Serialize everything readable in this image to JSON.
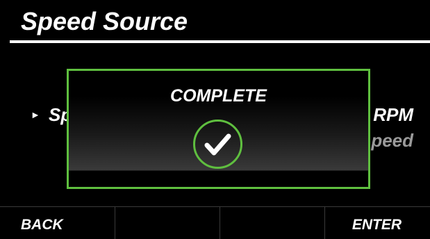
{
  "header": {
    "title": "Speed Source"
  },
  "menu": {
    "rows": [
      {
        "label": "Sp",
        "value": "RPM",
        "selected": true
      },
      {
        "label": "",
        "value": "peed",
        "selected": false
      }
    ]
  },
  "dialog": {
    "title": "COMPLETE",
    "icon": "checkmark-circle-icon",
    "accent_color": "#5fbf3f"
  },
  "softkeys": {
    "back_label": "BACK",
    "enter_label": "ENTER"
  }
}
